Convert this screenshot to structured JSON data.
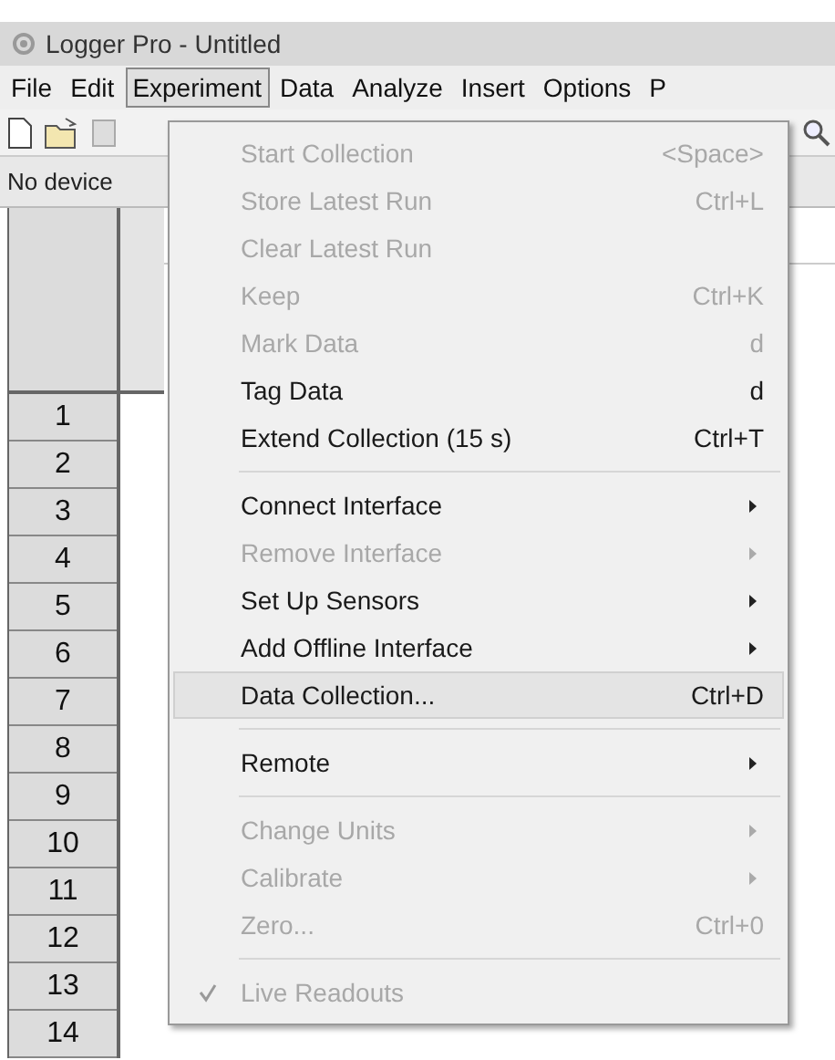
{
  "window": {
    "title": "Logger Pro - Untitled"
  },
  "menubar": [
    {
      "label": "File",
      "selected": false
    },
    {
      "label": "Edit",
      "selected": false
    },
    {
      "label": "Experiment",
      "selected": true
    },
    {
      "label": "Data",
      "selected": false
    },
    {
      "label": "Analyze",
      "selected": false
    },
    {
      "label": "Insert",
      "selected": false
    },
    {
      "label": "Options",
      "selected": false
    },
    {
      "label": "P",
      "selected": false
    }
  ],
  "status": {
    "text": "No device"
  },
  "table": {
    "row_numbers": [
      "1",
      "2",
      "3",
      "4",
      "5",
      "6",
      "7",
      "8",
      "9",
      "10",
      "11",
      "12",
      "13",
      "14"
    ]
  },
  "menu": {
    "items": [
      {
        "kind": "item",
        "label": "Start Collection",
        "shortcut": "<Space>",
        "disabled": true
      },
      {
        "kind": "item",
        "label": "Store Latest Run",
        "shortcut": "Ctrl+L",
        "disabled": true
      },
      {
        "kind": "item",
        "label": "Clear Latest Run",
        "disabled": true
      },
      {
        "kind": "item",
        "label": "Keep",
        "shortcut": "Ctrl+K",
        "disabled": true
      },
      {
        "kind": "item",
        "label": "Mark Data",
        "shortcut": "d",
        "disabled": true
      },
      {
        "kind": "item",
        "label": "Tag Data",
        "shortcut": "d",
        "disabled": false
      },
      {
        "kind": "item",
        "label": "Extend Collection (15 s)",
        "shortcut": "Ctrl+T",
        "disabled": false
      },
      {
        "kind": "separator"
      },
      {
        "kind": "submenu",
        "label": "Connect Interface",
        "disabled": false
      },
      {
        "kind": "submenu",
        "label": "Remove Interface",
        "disabled": true
      },
      {
        "kind": "submenu",
        "label": "Set Up Sensors",
        "disabled": false
      },
      {
        "kind": "submenu",
        "label": "Add Offline Interface",
        "disabled": false
      },
      {
        "kind": "item",
        "label": "Data Collection...",
        "shortcut": "Ctrl+D",
        "disabled": false,
        "selected": true
      },
      {
        "kind": "separator"
      },
      {
        "kind": "submenu",
        "label": "Remote",
        "disabled": false
      },
      {
        "kind": "separator"
      },
      {
        "kind": "submenu",
        "label": "Change Units",
        "disabled": true
      },
      {
        "kind": "submenu",
        "label": "Calibrate",
        "disabled": true
      },
      {
        "kind": "item",
        "label": "Zero...",
        "shortcut": "Ctrl+0",
        "disabled": true
      },
      {
        "kind": "separator"
      },
      {
        "kind": "check",
        "label": "Live Readouts",
        "disabled": true,
        "checked": true
      }
    ]
  }
}
